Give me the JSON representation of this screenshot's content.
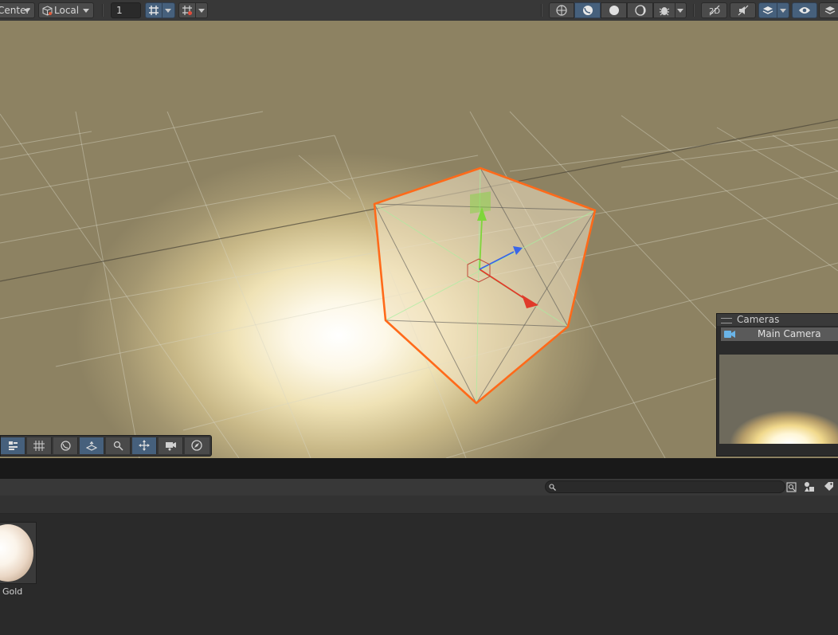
{
  "toolbar": {
    "pivot_mode": "Center",
    "pivot_rotation": "Local",
    "increment_value": "1"
  },
  "scene": {
    "overlay_tools": [
      "tool-settings",
      "grid-snapping",
      "render-mode",
      "orientation",
      "search",
      "transform",
      "camera",
      "navigation"
    ]
  },
  "cameras_panel": {
    "title": "Cameras",
    "selected_camera": "Main Camera"
  },
  "project": {
    "search_value": "",
    "assets": [
      {
        "name": "Gold",
        "type": "material"
      }
    ]
  },
  "colors": {
    "selection_outline": "#ff6a1a",
    "axis_y": "#7ed63a",
    "axis_x": "#e03a2a",
    "axis_z": "#3a66e8",
    "active_button": "#46607c"
  }
}
